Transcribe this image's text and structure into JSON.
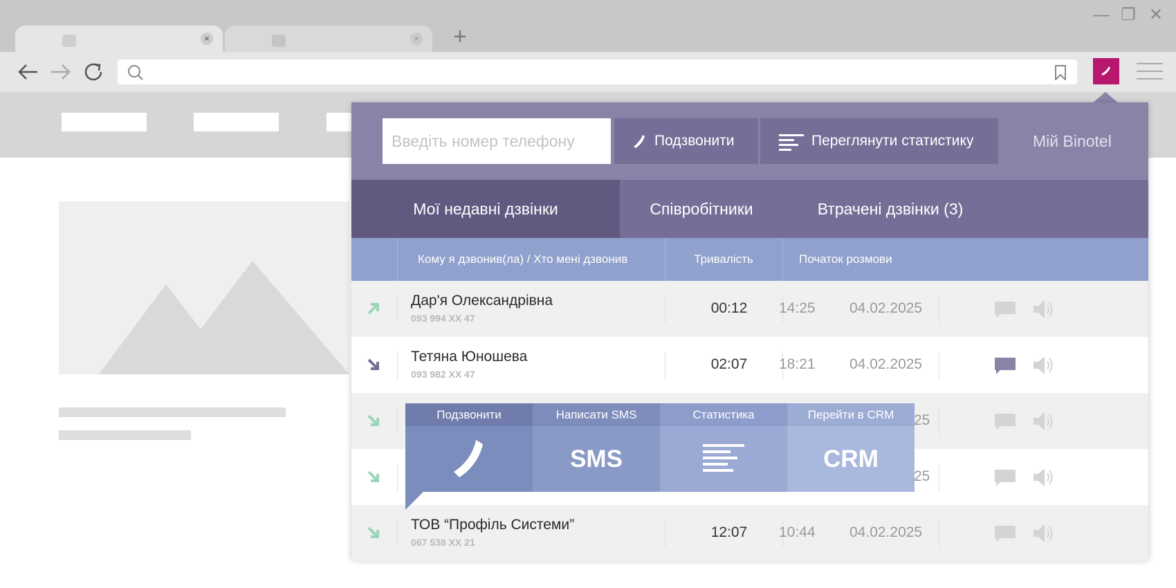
{
  "browser": {
    "tabs": [
      {
        "close": "×"
      },
      {
        "close": "×"
      }
    ],
    "new_tab": "+",
    "window_controls": {
      "minimize": "—",
      "maximize": "❐",
      "close": "✕"
    },
    "icons": {
      "back": "back-arrow-icon",
      "forward": "forward-arrow-icon",
      "reload": "reload-icon",
      "search": "search-icon",
      "bookmark": "bookmark-icon",
      "extension": "phone-icon",
      "menu": "hamburger-menu-icon"
    },
    "extension_color": "#b8176e"
  },
  "popup": {
    "phone_placeholder": "Введіть номер телефону",
    "call_button": "Подзвонити",
    "stats_button": "Переглянути статистику",
    "my_binotel": "Мій Binotel",
    "tabs": [
      "Мої недавні дзвінки",
      "Співробітники",
      "Втрачені дзвінки (3)"
    ],
    "active_tab": 0,
    "columns": {
      "who": "Кому я дзвонив(ла) / Хто мені дзвонив",
      "duration": "Тривалість",
      "start": "Початок розмови"
    },
    "rows": [
      {
        "direction": "outgoing",
        "name": "Дар'я Олександрівна",
        "number": "093 994 XX 47",
        "duration": "00:12",
        "time": "14:25",
        "date": "04.02.2025",
        "message_active": false
      },
      {
        "direction": "incoming",
        "name": "Тетяна Юношева",
        "number": "093 982 XX 47",
        "duration": "02:07",
        "time": "18:21",
        "date": "04.02.2025",
        "message_active": true
      },
      {
        "direction": "incoming-ok",
        "name": "",
        "number": "",
        "duration": "",
        "time": "",
        "date": "25",
        "message_active": false
      },
      {
        "direction": "incoming-ok",
        "name": "",
        "number": "",
        "duration": "",
        "time": "",
        "date": "25",
        "message_active": false
      },
      {
        "direction": "incoming-ok",
        "name": "ТОВ “Профіль Системи”",
        "number": "067 538 XX 21",
        "duration": "12:07",
        "time": "10:44",
        "date": "04.02.2025",
        "message_active": false
      }
    ],
    "actions": [
      {
        "label": "Подзвонити",
        "content": "",
        "icon": "phone-icon",
        "color": "#7b8dbd",
        "label_color": "#6f7cac"
      },
      {
        "label": "Написати SMS",
        "content": "SMS",
        "icon": "",
        "color": "#8a9ac6",
        "label_color": "#7d8cbb"
      },
      {
        "label": "Статистика",
        "content": "",
        "icon": "statistics-icon",
        "color": "#9aaad4",
        "label_color": "#8d9ccb"
      },
      {
        "label": "Перейти в CRM",
        "content": "CRM",
        "icon": "",
        "color": "#a9b9de",
        "label_color": "#9dacd4"
      }
    ],
    "colors": {
      "header": "#8b82a8",
      "tabs": "#776e98",
      "active_tab": "#615a80",
      "table_head": "#8fa1cc",
      "incoming_arrow": "#776e98",
      "ok_arrow": "#9ad6b6"
    }
  }
}
